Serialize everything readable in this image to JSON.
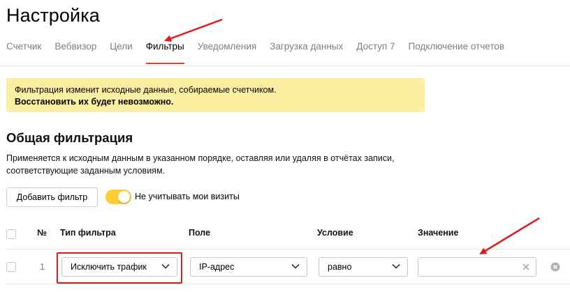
{
  "page": {
    "title": "Настройка"
  },
  "tabs": [
    {
      "label": "Счетчик",
      "active": false
    },
    {
      "label": "Вебвизор",
      "active": false
    },
    {
      "label": "Цели",
      "active": false
    },
    {
      "label": "Фильтры",
      "active": true
    },
    {
      "label": "Уведомления",
      "active": false
    },
    {
      "label": "Загрузка данных",
      "active": false
    },
    {
      "label": "Доступ 7",
      "active": false
    },
    {
      "label": "Подключение отчетов",
      "active": false
    }
  ],
  "warning": {
    "line1": "Фильтрация изменит исходные данные, собираемые счетчиком.",
    "line2": "Восстановить их будет невозможно."
  },
  "section": {
    "title": "Общая фильтрация",
    "description_line1": "Применяется к исходным данным в указанном порядке, оставляя или удаляя в отчётах записи,",
    "description_line2": "соответствующие заданным условиям."
  },
  "toolbar": {
    "add_filter_label": "Добавить фильтр",
    "ignore_visits_label": "Не учитывать мои визиты",
    "ignore_visits_on": true
  },
  "table": {
    "headers": {
      "num": "№",
      "type": "Тип фильтра",
      "field": "Поле",
      "condition": "Условие",
      "value": "Значение"
    },
    "rows": [
      {
        "num": "1",
        "type": "Исключить трафик",
        "field": "IP-адрес",
        "condition": "равно",
        "value": ""
      }
    ]
  },
  "colors": {
    "accent": "#ff3333",
    "warning_bg": "#fcefa2",
    "toggle_on": "#ffcc33",
    "annotation": "#e5161c"
  },
  "icons": {
    "chevron": "chevron-down-icon",
    "clear": "clear-icon",
    "remove": "remove-row-icon"
  }
}
